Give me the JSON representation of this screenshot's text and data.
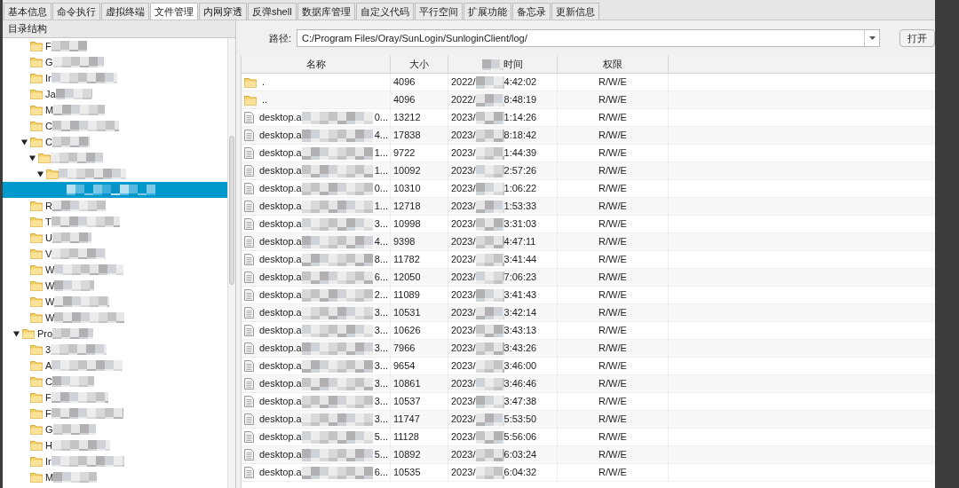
{
  "tabs": [
    {
      "label": "基本信息",
      "selected": false
    },
    {
      "label": "命令执行",
      "selected": false
    },
    {
      "label": "虚拟终端",
      "selected": false
    },
    {
      "label": "文件管理",
      "selected": true
    },
    {
      "label": "内网穿透",
      "selected": false
    },
    {
      "label": "反弹shell",
      "selected": false
    },
    {
      "label": "数据库管理",
      "selected": false
    },
    {
      "label": "自定义代码",
      "selected": false
    },
    {
      "label": "平行空间",
      "selected": false
    },
    {
      "label": "扩展功能",
      "selected": false
    },
    {
      "label": "备忘录",
      "selected": false
    },
    {
      "label": "更新信息",
      "selected": false
    }
  ],
  "tree": {
    "title": "目录结构",
    "items": [
      {
        "children": [
          {
            "label": "F",
            "selected": false
          },
          {
            "label": "G",
            "selected": false
          },
          {
            "label": "Ir",
            "selected": false
          },
          {
            "label": "Ja",
            "selected": false
          },
          {
            "label": "M",
            "selected": false
          },
          {
            "label": "C",
            "selected": false
          },
          {
            "label": "C",
            "selected": false,
            "expanded": true,
            "children": [
              {
                "selected": false,
                "expanded": true,
                "children": [
                  {
                    "selected": false,
                    "expanded": true,
                    "children": [
                      {
                        "selected": true
                      }
                    ]
                  }
                ]
              }
            ]
          },
          {
            "label": "R",
            "selected": false
          },
          {
            "label": "T",
            "selected": false
          },
          {
            "label": "U",
            "selected": false
          },
          {
            "label": "V",
            "selected": false
          },
          {
            "label": "W",
            "selected": false
          },
          {
            "label": "W",
            "selected": false
          },
          {
            "label": "W",
            "selected": false
          },
          {
            "label": "W",
            "selected": false
          }
        ]
      },
      {
        "label": "Pro",
        "selected": false,
        "expanded": true,
        "children": [
          {
            "label": "3",
            "selected": false
          },
          {
            "label": "A",
            "selected": false
          },
          {
            "label": "C",
            "selected": false
          },
          {
            "label": "F",
            "selected": false
          },
          {
            "label": "F",
            "selected": false
          },
          {
            "label": "G",
            "selected": false
          },
          {
            "label": "H",
            "selected": false
          },
          {
            "label": "Ir",
            "selected": false
          },
          {
            "label": "M",
            "selected": false
          }
        ]
      }
    ]
  },
  "path": {
    "label": "路径:",
    "value": "C:/Program Files/Oray/SunLogin/SunloginClient/log/",
    "open_button": "打开"
  },
  "table": {
    "columns": [
      "名称",
      "大小",
      "时间",
      "权限"
    ],
    "rows": [
      {
        "kind": "folder",
        "name": ".",
        "size": "4096",
        "date": "2022/",
        "time": "4:42:02",
        "perm": "R/W/E"
      },
      {
        "kind": "folder",
        "name": "..",
        "size": "4096",
        "date": "2022/",
        "time": "8:48:19",
        "perm": "R/W/E"
      },
      {
        "kind": "file",
        "name": "desktop.a",
        "tail": "0...",
        "size": "13212",
        "date": "2023/",
        "time": "1:14:26",
        "perm": "R/W/E"
      },
      {
        "kind": "file",
        "name": "desktop.a",
        "tail": "4...",
        "size": "17838",
        "date": "2023/",
        "time": "8:18:42",
        "perm": "R/W/E"
      },
      {
        "kind": "file",
        "name": "desktop.a",
        "tail": "1...",
        "size": "9722",
        "date": "2023/",
        "time": "1:44:39",
        "perm": "R/W/E"
      },
      {
        "kind": "file",
        "name": "desktop.a",
        "tail": "1...",
        "size": "10092",
        "date": "2023/",
        "time": "2:57:26",
        "perm": "R/W/E"
      },
      {
        "kind": "file",
        "name": "desktop.a",
        "tail": "0...",
        "size": "10310",
        "date": "2023/",
        "time": "1:06:22",
        "perm": "R/W/E"
      },
      {
        "kind": "file",
        "name": "desktop.a",
        "tail": "1...",
        "size": "12718",
        "date": "2023/",
        "time": "1:53:33",
        "perm": "R/W/E"
      },
      {
        "kind": "file",
        "name": "desktop.a",
        "tail": "3...",
        "size": "10998",
        "date": "2023/",
        "time": "3:31:03",
        "perm": "R/W/E"
      },
      {
        "kind": "file",
        "name": "desktop.a",
        "tail": "4...",
        "size": "9398",
        "date": "2023/",
        "time": "4:47:11",
        "perm": "R/W/E"
      },
      {
        "kind": "file",
        "name": "desktop.a",
        "tail": "8...",
        "size": "11782",
        "date": "2023/",
        "time": "3:41:44",
        "perm": "R/W/E"
      },
      {
        "kind": "file",
        "name": "desktop.a",
        "tail": "6...",
        "size": "12050",
        "date": "2023/",
        "time": "7:06:23",
        "perm": "R/W/E"
      },
      {
        "kind": "file",
        "name": "desktop.a",
        "tail": "2...",
        "size": "11089",
        "date": "2023/",
        "time": "3:41:43",
        "perm": "R/W/E"
      },
      {
        "kind": "file",
        "name": "desktop.a",
        "tail": "3...",
        "size": "10531",
        "date": "2023/",
        "time": "3:42:14",
        "perm": "R/W/E"
      },
      {
        "kind": "file",
        "name": "desktop.a",
        "tail": "3...",
        "size": "10626",
        "date": "2023/",
        "time": "3:43:13",
        "perm": "R/W/E"
      },
      {
        "kind": "file",
        "name": "desktop.a",
        "tail": "3...",
        "size": "7966",
        "date": "2023/",
        "time": "3:43:26",
        "perm": "R/W/E"
      },
      {
        "kind": "file",
        "name": "desktop.a",
        "tail": "3...",
        "size": "9654",
        "date": "2023/",
        "time": "3:46:00",
        "perm": "R/W/E"
      },
      {
        "kind": "file",
        "name": "desktop.a",
        "tail": "3...",
        "size": "10861",
        "date": "2023/",
        "time": "3:46:46",
        "perm": "R/W/E"
      },
      {
        "kind": "file",
        "name": "desktop.a",
        "tail": "3...",
        "size": "10537",
        "date": "2023/",
        "time": "3:47:38",
        "perm": "R/W/E"
      },
      {
        "kind": "file",
        "name": "desktop.a",
        "tail": "3...",
        "size": "11747",
        "date": "2023/",
        "time": "5:53:50",
        "perm": "R/W/E"
      },
      {
        "kind": "file",
        "name": "desktop.a",
        "tail": "5...",
        "size": "11128",
        "date": "2023/",
        "time": "5:56:06",
        "perm": "R/W/E"
      },
      {
        "kind": "file",
        "name": "desktop.a",
        "tail": "5...",
        "size": "10892",
        "date": "2023/",
        "time": "6:03:24",
        "perm": "R/W/E"
      },
      {
        "kind": "file",
        "name": "desktop.a",
        "tail": "6...",
        "size": "10535",
        "date": "2023/",
        "time": "6:04:32",
        "perm": "R/W/E"
      }
    ]
  }
}
